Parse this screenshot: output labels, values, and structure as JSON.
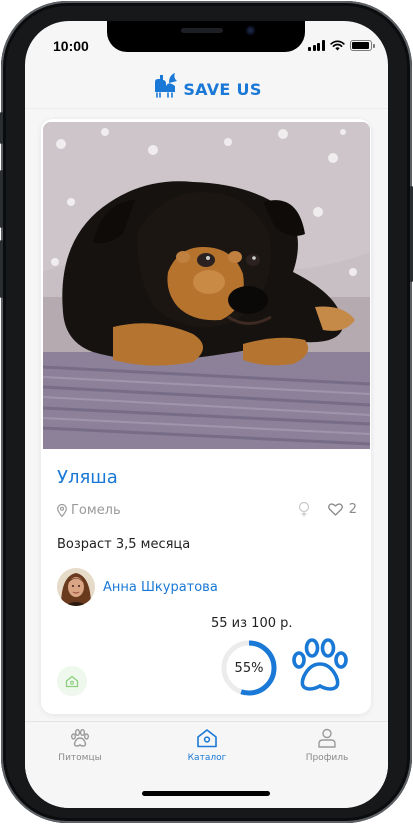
{
  "status_bar": {
    "time": "10:00"
  },
  "header": {
    "logo_text": "SAVE US"
  },
  "pet": {
    "name": "Уляша",
    "location": "Гомель",
    "likes": "2",
    "age": "Возраст 3,5 месяца"
  },
  "owner": {
    "name": "Анна Шкуратова"
  },
  "donation": {
    "progress_text": "55 из 100 р.",
    "percent_label": "55%",
    "collected": 55,
    "goal": 100,
    "fraction": 0.55
  },
  "tabs": [
    {
      "label": "Питомцы",
      "icon": "paw-icon",
      "active": false
    },
    {
      "label": "Каталог",
      "icon": "house-icon",
      "active": true
    },
    {
      "label": "Профиль",
      "icon": "user-icon",
      "active": false
    }
  ],
  "colors": {
    "accent": "#1a78d6",
    "muted": "#9a9a9a",
    "home_btn_bg": "#eef8ec",
    "home_btn_icon": "#8ccf7e"
  }
}
